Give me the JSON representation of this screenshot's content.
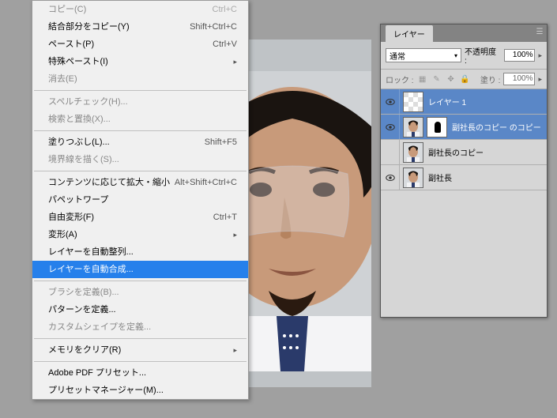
{
  "menu": {
    "items": [
      {
        "label": "コピー(C)",
        "shortcut": "Ctrl+C",
        "disabled": true
      },
      {
        "label": "結合部分をコピー(Y)",
        "shortcut": "Shift+Ctrl+C",
        "disabled": false
      },
      {
        "label": "ペースト(P)",
        "shortcut": "Ctrl+V",
        "disabled": false
      },
      {
        "label": "特殊ペースト(I)",
        "shortcut": "",
        "disabled": false,
        "submenu": true
      },
      {
        "label": "消去(E)",
        "shortcut": "",
        "disabled": true
      },
      {
        "sep": true
      },
      {
        "label": "スペルチェック(H)...",
        "shortcut": "",
        "disabled": true
      },
      {
        "label": "検索と置換(X)...",
        "shortcut": "",
        "disabled": true
      },
      {
        "sep": true
      },
      {
        "label": "塗りつぶし(L)...",
        "shortcut": "Shift+F5",
        "disabled": false
      },
      {
        "label": "境界線を描く(S)...",
        "shortcut": "",
        "disabled": true
      },
      {
        "sep": true
      },
      {
        "label": "コンテンツに応じて拡大・縮小",
        "shortcut": "Alt+Shift+Ctrl+C",
        "disabled": false
      },
      {
        "label": "パペットワープ",
        "shortcut": "",
        "disabled": false
      },
      {
        "label": "自由変形(F)",
        "shortcut": "Ctrl+T",
        "disabled": false
      },
      {
        "label": "変形(A)",
        "shortcut": "",
        "disabled": false,
        "submenu": true
      },
      {
        "label": "レイヤーを自動整列...",
        "shortcut": "",
        "disabled": false
      },
      {
        "label": "レイヤーを自動合成...",
        "shortcut": "",
        "disabled": false,
        "selected": true
      },
      {
        "sep": true
      },
      {
        "label": "ブラシを定義(B)...",
        "shortcut": "",
        "disabled": true
      },
      {
        "label": "パターンを定義...",
        "shortcut": "",
        "disabled": false
      },
      {
        "label": "カスタムシェイプを定義...",
        "shortcut": "",
        "disabled": true
      },
      {
        "sep": true
      },
      {
        "label": "メモリをクリア(R)",
        "shortcut": "",
        "disabled": false,
        "submenu": true
      },
      {
        "sep": true
      },
      {
        "label": "Adobe PDF プリセット...",
        "shortcut": "",
        "disabled": false
      },
      {
        "label": "プリセットマネージャー(M)...",
        "shortcut": "",
        "disabled": false
      }
    ]
  },
  "layers_panel": {
    "tab_label": "レイヤー",
    "blend_mode": "通常",
    "opacity_label": "不透明度 :",
    "opacity_value": "100%",
    "lock_label": "ロック :",
    "fill_label": "塗り :",
    "fill_value": "100%",
    "layers": [
      {
        "name": "レイヤー 1",
        "visible": true,
        "selected": true,
        "mask": false,
        "thumb": "checker"
      },
      {
        "name": "副社長のコピー のコピー",
        "visible": true,
        "selected": true,
        "mask": true,
        "thumb": "face"
      },
      {
        "name": "副社長のコピー",
        "visible": false,
        "selected": false,
        "mask": false,
        "thumb": "face"
      },
      {
        "name": "副社長",
        "visible": true,
        "selected": false,
        "mask": false,
        "thumb": "face"
      }
    ]
  }
}
